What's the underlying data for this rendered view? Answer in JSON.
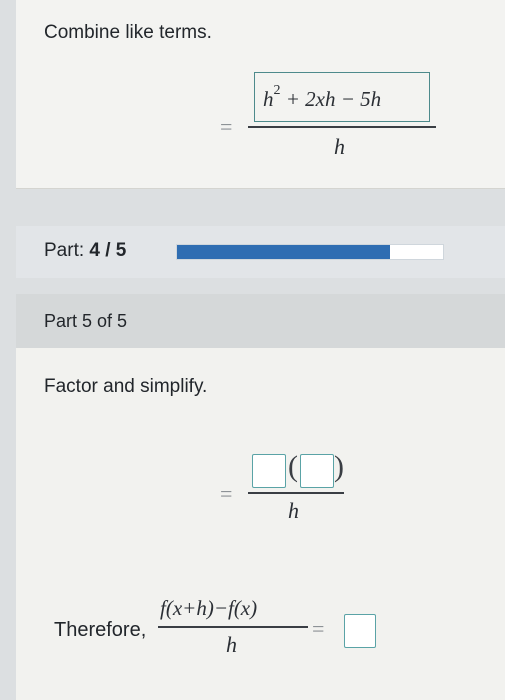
{
  "combine_step": {
    "instruction": "Combine like terms.",
    "equals": "=",
    "answer_numerator": {
      "h": "h",
      "exponent": "2",
      "rest": "+ 2xh − 5h"
    },
    "denominator": "h"
  },
  "progress": {
    "label_prefix": "Part:",
    "label_value": "4 / 5",
    "completed": 4,
    "total": 5,
    "fill_percent": 80,
    "fill_color": "#2f6db2"
  },
  "part_header": {
    "title": "Part 5 of 5"
  },
  "factor_step": {
    "instruction": "Factor and simplify.",
    "equals": "=",
    "open_paren": "(",
    "close_paren": ")",
    "denominator": "h"
  },
  "therefore": {
    "label": "Therefore,",
    "numerator": "f(x+h)−f(x)",
    "denominator": "h",
    "equals": "="
  },
  "colors": {
    "input_border": "#5aa3a6",
    "progress_fill": "#2f6db2"
  }
}
